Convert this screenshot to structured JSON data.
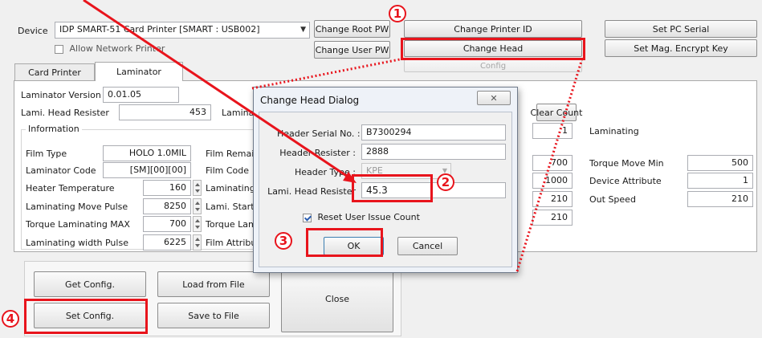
{
  "toolbar": {
    "device_label": "Device",
    "device_value": "IDP SMART-51 Card Printer  [SMART : USB002]",
    "allow_network_printer": "Allow Network Printer",
    "change_root_pw": "Change Root PW",
    "change_user_pw": "Change User PW",
    "change_printer_id": "Change Printer ID",
    "change_head": "Change Head",
    "config": "Config",
    "set_pc_serial": "Set PC Serial",
    "set_mag_encrypt_key": "Set Mag. Encrypt Key"
  },
  "tabs": [
    "Card Printer",
    "Laminator"
  ],
  "laminator": {
    "version_label": "Laminator Version",
    "version_value": "0.01.05",
    "head_resister_label": "Lami. Head Resister",
    "head_resister_value": "453",
    "lamina_cut": "Lamina",
    "information_label": "Information",
    "rows": [
      {
        "label": "Film Type",
        "value": "HOLO  1.0MIL",
        "right_label": "Film Remain"
      },
      {
        "label": "Laminator Code",
        "value": "[SM][00][00]",
        "right_label": "Film Code"
      },
      {
        "label": "Heater Temperature",
        "value": "160",
        "right_label": "Laminating Pl"
      },
      {
        "label": "Laminating Move Pulse",
        "value": "8250",
        "right_label": "Lami. Start O"
      },
      {
        "label": "Torque Laminating MAX",
        "value": "700",
        "right_label": "Torque Lamin"
      },
      {
        "label": "Laminating width Pulse",
        "value": "6225",
        "right_label": "Film Attribute"
      }
    ],
    "clear_count": "Clear Count",
    "count_value": "1",
    "laminating_label": "Laminating",
    "mid_values": [
      "700",
      "1000",
      "210",
      "210"
    ],
    "right_rows": [
      {
        "label": "Torque Move Min",
        "value": "500"
      },
      {
        "label": "Device Attribute",
        "value": "1"
      },
      {
        "label": "Out Speed",
        "value": "210"
      }
    ]
  },
  "actions": {
    "get_config": "Get Config.",
    "load_from_file": "Load from File",
    "close": "Close",
    "set_config": "Set Config.",
    "save_to_file": "Save to File"
  },
  "dialog": {
    "title": "Change Head Dialog",
    "close_glyph": "✕",
    "header_serial_label": "Header Serial No. :",
    "header_serial_value": "B7300294",
    "header_resister_label": "Header Resister :",
    "header_resister_value": "2888",
    "header_type_label": "Header Type :",
    "header_type_value": "KPE",
    "lami_head_label": "Lami. Head Resister",
    "lami_head_value": "45.3",
    "reset_label": "Reset User Issue Count",
    "ok": "OK",
    "cancel": "Cancel"
  },
  "annotations": {
    "step1": "1",
    "step2": "2",
    "step3": "3",
    "step4": "4",
    "color": "#e8141c"
  }
}
